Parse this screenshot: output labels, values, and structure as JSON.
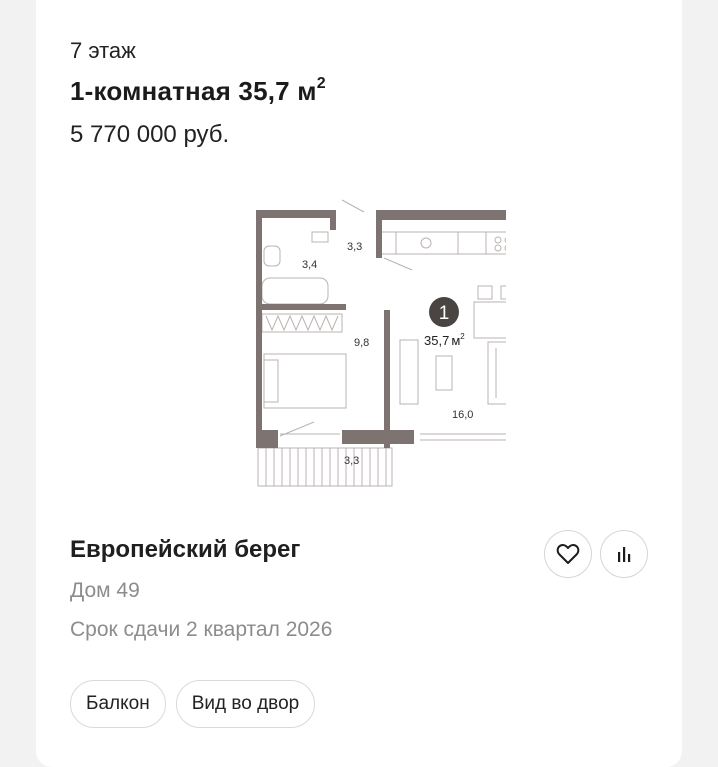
{
  "listing": {
    "floor": "7 этаж",
    "title": "1-комнатная 35,7 м",
    "title_sup": "2",
    "price": "5 770 000 руб."
  },
  "plan": {
    "room_number": "1",
    "total_area": "35,7",
    "total_unit": "м",
    "total_sup": "2",
    "areas": {
      "corridor": "3,3",
      "bathroom": "3,4",
      "bedroom": "9,8",
      "living": "16,0",
      "balcony": "3,3"
    }
  },
  "complex": {
    "name": "Европейский берег",
    "house": "Дом 49",
    "deadline": "Срок сдачи 2 квартал 2026"
  },
  "tags": [
    "Балкон",
    "Вид во двор"
  ],
  "icons": {
    "favorite": "heart-icon",
    "compare": "bar-chart-icon"
  },
  "colors": {
    "wall": "#7d7370",
    "badge": "#4a4543",
    "muted_text": "#8c8c8c"
  }
}
